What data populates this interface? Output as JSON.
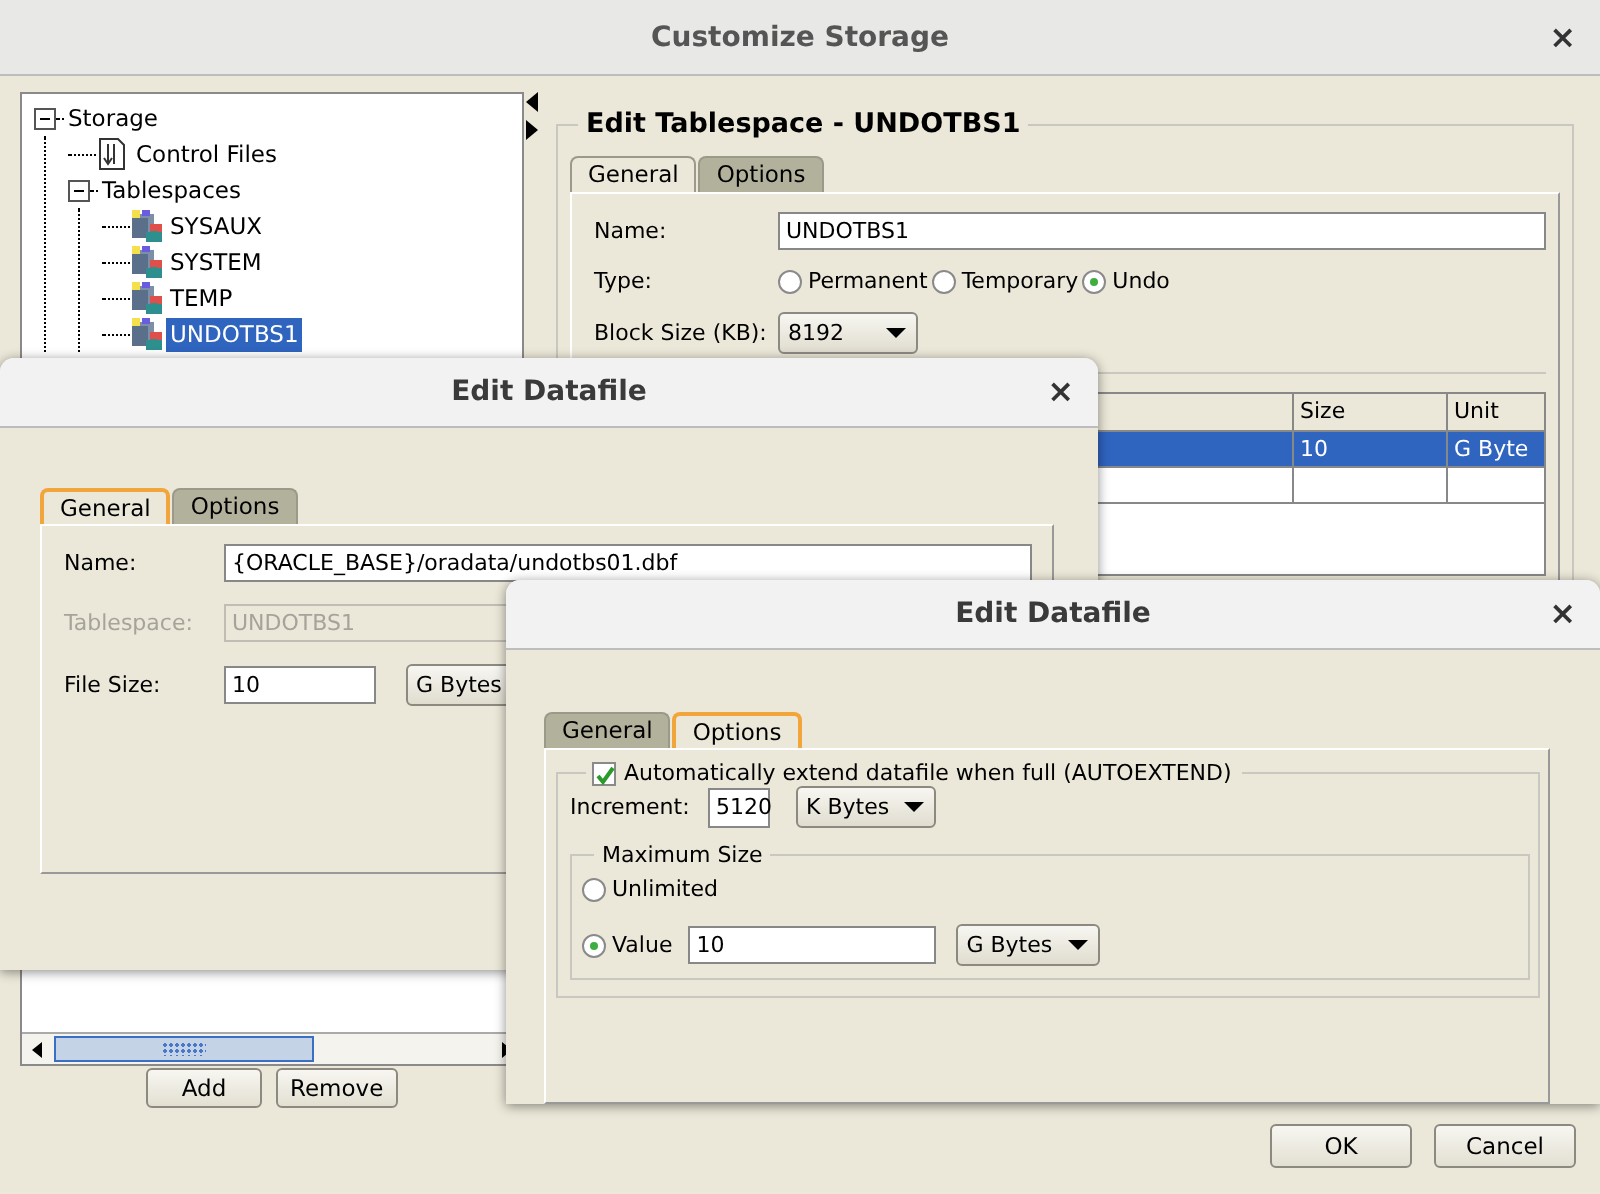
{
  "window": {
    "title": "Customize Storage",
    "close": "×"
  },
  "tree": [
    {
      "label": "Storage",
      "expanded": true,
      "selected": false,
      "children": [
        {
          "label": "Control Files",
          "kind": "file",
          "selected": false
        },
        {
          "label": "Tablespaces",
          "expanded": true,
          "selected": false,
          "children": [
            {
              "label": "SYSAUX",
              "kind": "tablespace",
              "selected": false
            },
            {
              "label": "SYSTEM",
              "kind": "tablespace",
              "selected": false
            },
            {
              "label": "TEMP",
              "kind": "tablespace",
              "selected": false
            },
            {
              "label": "UNDOTBS1",
              "kind": "tablespace",
              "selected": true
            }
          ]
        }
      ]
    }
  ],
  "tree_buttons": [
    "Add",
    "Remove"
  ],
  "editor": {
    "title": "Edit Tablespace - UNDOTBS1",
    "tabs": [
      {
        "label": "General",
        "selected": true
      },
      {
        "label": "Options",
        "selected": false
      }
    ],
    "name_label": "Name:",
    "name": "UNDOTBS1",
    "type_label": "Type:",
    "types": [
      {
        "label": "Permanent",
        "selected": false
      },
      {
        "label": "Temporary",
        "selected": false
      },
      {
        "label": "Undo",
        "selected": true
      }
    ],
    "block_size_label": "Block Size (KB):",
    "block_size": "8192",
    "datafiles": {
      "columns": [
        "Size",
        "Unit"
      ],
      "rows": [
        {
          "cells": [
            "10",
            "G Byte"
          ],
          "selected": true
        }
      ]
    }
  },
  "dialogs": [
    {
      "title": "Edit Datafile",
      "close": "×",
      "kind": "general",
      "tabs": [
        {
          "label": "General",
          "selected": true
        },
        {
          "label": "Options",
          "selected": false
        }
      ],
      "fields": [
        {
          "label": "Name:",
          "value": "{ORACLE_BASE}/oradata/undotbs01.dbf",
          "disabled": false,
          "kind": "wide"
        },
        {
          "label": "Tablespace:",
          "value": "UNDOTBS1",
          "disabled": true,
          "kind": "medium"
        },
        {
          "label": "File Size:",
          "value": "10",
          "disabled": false,
          "kind": "number",
          "unit": "G Bytes"
        }
      ]
    },
    {
      "title": "Edit Datafile",
      "close": "×",
      "kind": "options",
      "tabs": [
        {
          "label": "General",
          "selected": false
        },
        {
          "label": "Options",
          "selected": true
        }
      ],
      "autoextend": {
        "label": "Automatically extend datafile when full (AUTOEXTEND)",
        "checked": true
      },
      "increment_label": "Increment:",
      "increment": "5120",
      "increment_unit": "K Bytes",
      "max_size": {
        "title": "Maximum Size",
        "options": [
          {
            "label": "Unlimited",
            "selected": false
          },
          {
            "label": "Value",
            "selected": true,
            "value": "10",
            "unit": "G Bytes"
          }
        ]
      }
    }
  ],
  "buttons": [
    "OK",
    "Cancel"
  ]
}
